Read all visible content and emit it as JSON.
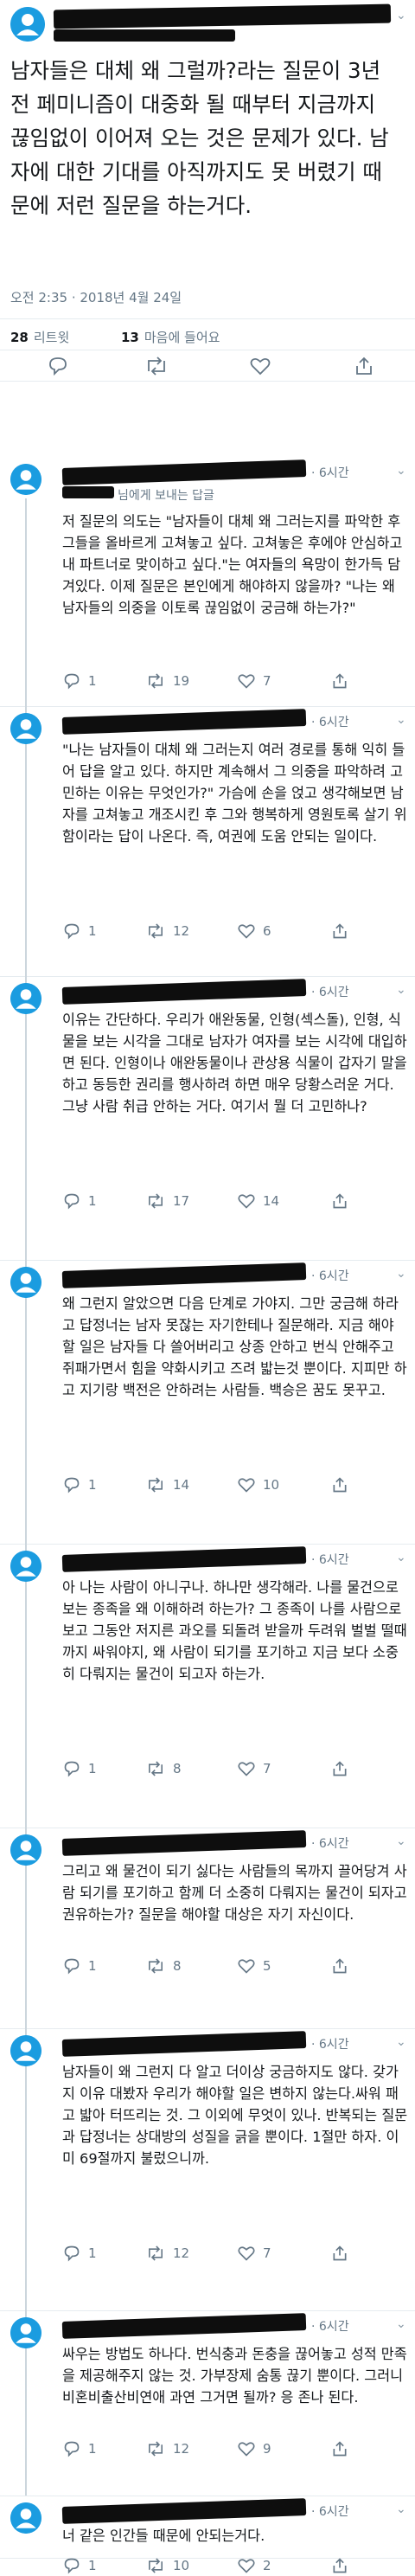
{
  "main_tweet": {
    "text": "남자들은 대체 왜 그럴까?라는 질문이 3년 전 페미니즘이 대중화 될 때부터 지금까지 끊임없이 이어져 오는 것은 문제가 있다. 남자에 대한 기대를 아직까지도 못 버렸기 때문에 저런 질문을 하는거다.",
    "timestamp": "오전 2:35 · 2018년 4월 24일",
    "retweet_count": "28",
    "retweet_label": "리트윗",
    "like_count": "13",
    "like_label": "마음에 들어요"
  },
  "replies": [
    {
      "time": "· 6시간",
      "reply_to": "님에게 보내는 답글",
      "text": "저 질문의 의도는 \"남자들이 대체 왜 그러는지를 파악한 후 그들을 올바르게 고쳐놓고 싶다. 고쳐놓은 후에야 안심하고 내 파트너로 맞이하고 싶다.\"는 여자들의 욕망이 한가득 담겨있다. 이제 질문은 본인에게 해야하지 않을까? \"나는 왜 남자들의 의중을 이토록 끊임없이 궁금해 하는가?\"",
      "replies": "1",
      "retweets": "19",
      "likes": "7"
    },
    {
      "time": "· 6시간",
      "reply_to": "",
      "text": "\"나는 남자들이 대체 왜 그러는지 여러 경로를 통해 익히 들어 답을 알고 있다. 하지만 계속해서 그 의중을 파악하려 고민하는 이유는 무엇인가?\" 가슴에 손을 얹고 생각해보면 남자를 고쳐놓고 개조시킨 후 그와 행복하게 영원토록 살기 위함이라는 답이 나온다. 즉, 여권에 도움 안되는 일이다.",
      "replies": "1",
      "retweets": "12",
      "likes": "6"
    },
    {
      "time": "· 6시간",
      "reply_to": "",
      "text": "이유는 간단하다. 우리가 애완동물, 인형(섹스돌), 인형, 식물을 보는 시각을 그대로 남자가 여자를 보는 시각에 대입하면 된다. 인형이나 애완동물이나 관상용 식물이 갑자기 말을 하고 동등한 권리를 행사하려 하면 매우 당황스러운 거다. 그냥 사람 취급 안하는 거다. 여기서 뭘 더 고민하나?",
      "replies": "1",
      "retweets": "17",
      "likes": "14"
    },
    {
      "time": "· 6시간",
      "reply_to": "",
      "text": "왜 그런지 알았으면 다음 단계로 가야지. 그만 궁금해 하라고 답정너는 남자 못잖는 자기한테나 질문해라. 지금 해야 할 일은 남자들 다 쓸어버리고 상종 안하고 번식 안해주고 쥐패가면서 힘을 약화시키고 즈려 밟는것 뿐이다. 지피만 하고 지기랑 백전은 안하려는 사람들. 백승은 꿈도 못꾸고.",
      "replies": "1",
      "retweets": "14",
      "likes": "10"
    },
    {
      "time": "· 6시간",
      "reply_to": "",
      "text": "아 나는 사람이 아니구나. 하나만 생각해라. 나를 물건으로 보는 종족을 왜 이해하려 하는가? 그 종족이 나를 사람으로 보고 그동안 저지른 과오를 되돌려 받을까 두려워 벌벌 떨때까지 싸워야지, 왜 사람이 되기를 포기하고 지금 보다 소중히 다뤄지는 물건이 되고자 하는가.",
      "replies": "1",
      "retweets": "8",
      "likes": "7"
    },
    {
      "time": "· 6시간",
      "reply_to": "",
      "text": "그리고 왜 물건이 되기 싫다는 사람들의 목까지 끌어당겨 사람 되기를 포기하고 함께 더 소중히 다뤄지는 물건이 되자고 권유하는가? 질문을 해야할 대상은 자기 자신이다.",
      "replies": "1",
      "retweets": "8",
      "likes": "5"
    },
    {
      "time": "· 6시간",
      "reply_to": "",
      "text": "남자들이 왜 그런지 다 알고 더이상 궁금하지도 않다. 갖가지 이유 대봤자 우리가 해야할 일은 변하지 않는다.싸워 패고 밟아 터뜨리는 것. 그 이외에 무엇이 있나. 반복되는 질문과 답정너는 상대방의 성질을 긁을 뿐이다. 1절만 하자. 이미 69절까지 불렀으니까.",
      "replies": "1",
      "retweets": "12",
      "likes": "7"
    },
    {
      "time": "· 6시간",
      "reply_to": "",
      "text": "싸우는 방법도 하나다. 번식충과 돈충을 끊어놓고 성적 만족을 제공해주지 않는 것. 가부장제 숨통 끊기 뿐이다. 그러니 비혼비출산비연애 과연 그거면 될까? 응 존나 된다.",
      "replies": "1",
      "retweets": "12",
      "likes": "9"
    },
    {
      "time": "· 6시간",
      "reply_to": "",
      "text": "너 같은 인간들 때문에 안되는거다.",
      "replies": "1",
      "retweets": "10",
      "likes": "2"
    }
  ],
  "colors": {
    "avatar": "#1b9ce0",
    "text": "#14171a",
    "secondary": "#657786",
    "divider": "#e6ecf0",
    "thread": "#ccd6dd"
  },
  "icons": [
    "avatar-icon",
    "reply-icon",
    "retweet-icon",
    "like-icon",
    "share-icon",
    "chevron-down-icon"
  ]
}
